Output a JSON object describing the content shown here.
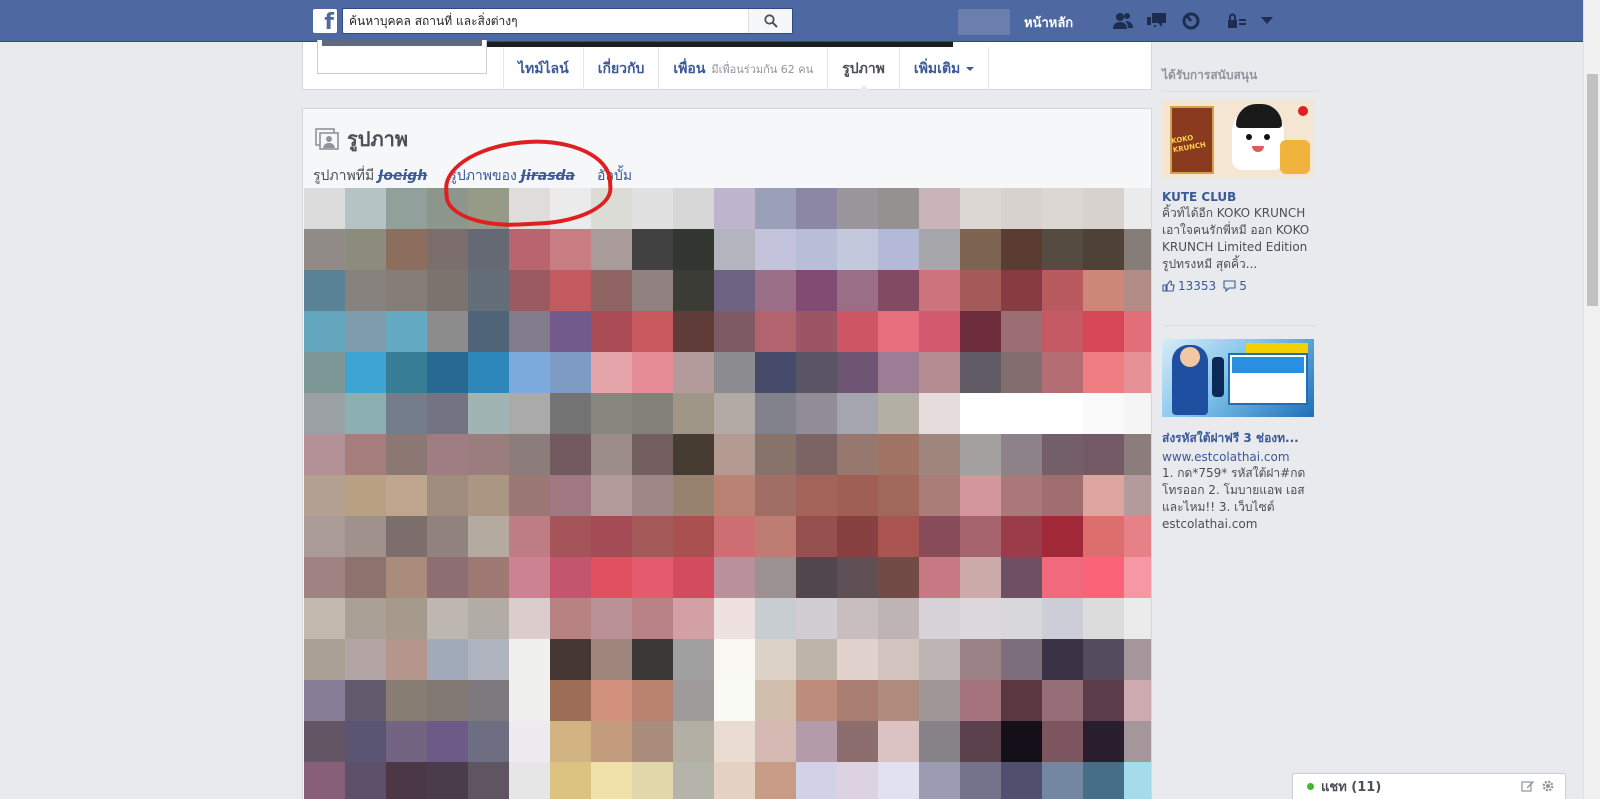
{
  "topbar": {
    "logo": "f",
    "search_placeholder": "ค้นหาบุคคล สถานที่ และสิ่งต่างๆ",
    "home_label": "หน้าหลัก",
    "icons": [
      "friend-requests-icon",
      "messages-icon",
      "notifications-icon",
      "privacy-lock-icon",
      "account-menu-caret-icon"
    ]
  },
  "timeline_nav": {
    "tabs": [
      {
        "label": "ไทม์ไลน์"
      },
      {
        "label": "เกี่ยวกับ"
      },
      {
        "label": "เพื่อน",
        "sub": "มีเพื่อนร่วมกัน 62 คน"
      },
      {
        "label": "รูปภาพ",
        "active": true
      },
      {
        "label": "เพิ่มเติม"
      }
    ]
  },
  "photos": {
    "title": "รูปภาพ",
    "subtabs": {
      "photos_of_prefix": "รูปภาพที่มี",
      "photos_of_name": "Joeigh",
      "photos_by_prefix": "รูปภาพของ",
      "photos_by_name": "Jirasda",
      "albums": "อัลบั้ม"
    },
    "mosaic_colors": [
      [
        "#dcdcdc",
        "#b4c3c3",
        "#91a09b",
        "#8c968c",
        "#969b87",
        "#e1dcdc",
        "#ebebeb",
        "#dcdcd7",
        "#e1e1e1",
        "#d7d7d7",
        "#beb4cd",
        "#9ba0b9",
        "#8c87a5",
        "#9b969b",
        "#969191",
        "#c8b4b9",
        "#dcd7d2",
        "#d7d2cd",
        "#dcd7d2",
        "#d7d2cd",
        "#ebebeb"
      ],
      [
        "#918c87",
        "#8c8c7d",
        "#8c6e5f",
        "#7d6e6e",
        "#646973",
        "#b9646e",
        "#c87d82",
        "#aa9b9b",
        "#414141",
        "#323732",
        "#b4b4be",
        "#c3c3dc",
        "#b9bed7",
        "#c3c8dc",
        "#b4b9d7",
        "#a5a5aa",
        "#7d6450",
        "#5a3c32",
        "#554b41",
        "#504137",
        "#877d78"
      ],
      [
        "#5a8296",
        "#87827d",
        "#877d78",
        "#7d736e",
        "#646e78",
        "#9b5a5f",
        "#c35a5f",
        "#916464",
        "#918282",
        "#3c3c37",
        "#6e6482",
        "#9b6e87",
        "#824b73",
        "#9b6e87",
        "#824b64",
        "#cd737d",
        "#a55a5a",
        "#873c41",
        "#b95a5f",
        "#cd8778",
        "#b48c87"
      ],
      [
        "#64a5be",
        "#7d9baa",
        "#64aac3",
        "#8c8c8c",
        "#506478",
        "#827d8c",
        "#735a8c",
        "#aa4b55",
        "#c85a5f",
        "#5f3c37",
        "#7d5a64",
        "#b4646e",
        "#9b5564",
        "#cd5564",
        "#e66e7d",
        "#d25a6e",
        "#6e2d3c",
        "#9b6e73",
        "#c35a64",
        "#d74655",
        "#e16e78"
      ],
      [
        "#7d9696",
        "#3ca5d2",
        "#377d96",
        "#286991",
        "#2d87b9",
        "#7daadc",
        "#7d9bc3",
        "#e6a5aa",
        "#e68c96",
        "#b49b9b",
        "#8c8c91",
        "#464b69",
        "#5a5564",
        "#6e5573",
        "#9b7d96",
        "#b48c91",
        "#5f5a64",
        "#826e6e",
        "#b46e73",
        "#f07d82",
        "#e69196"
      ],
      [
        "#9ba0a5",
        "#8cafb4",
        "#737d8c",
        "#737382",
        "#a0b4b4",
        "#aaaaaa",
        "#737373",
        "#87877d",
        "#828278",
        "#a09687",
        "#b4aaa5",
        "#82828c",
        "#918c96",
        "#a5a5af",
        "#b4afa5",
        "#e6dcdc",
        "#ffffff",
        "#ffffff",
        "#ffffff",
        "#fafafa",
        "#f5f5f5"
      ],
      [
        "#b49196",
        "#a57d7d",
        "#8c7873",
        "#a07d82",
        "#9b7d7d",
        "#8c7d7d",
        "#735a5f",
        "#9b8c87",
        "#735f5f",
        "#463c32",
        "#b49b91",
        "#877369",
        "#7d6464",
        "#96786e",
        "#a07364",
        "#a0877d",
        "#a5a0a0",
        "#8c8287",
        "#735f69",
        "#735a64",
        "#8c7d7d"
      ],
      [
        "#b4a091",
        "#b9a082",
        "#bea58c",
        "#a08c7d",
        "#aa9682",
        "#9b7873",
        "#a07882",
        "#b49b9b",
        "#a08787",
        "#96826e",
        "#b98273",
        "#a06e64",
        "#a5645a",
        "#a05f55",
        "#a0695a",
        "#aa7d78",
        "#d2969b",
        "#aa7878",
        "#a06e6e",
        "#dca5a0",
        "#b49b9b"
      ],
      [
        "#aa9b96",
        "#a0918c",
        "#7d6e6e",
        "#91827d",
        "#b4aaa0",
        "#be7d82",
        "#a5555a",
        "#a54b55",
        "#a55a5a",
        "#aa5050",
        "#cd6e73",
        "#be7d73",
        "#965050",
        "#874141",
        "#aa5550",
        "#874b5a",
        "#a5646e",
        "#9b3c4b",
        "#a02837",
        "#dc6e6e",
        "#e68287"
      ],
      [
        "#a08282",
        "#8c736e",
        "#aa8c7d",
        "#8c6e73",
        "#a07873",
        "#cd8291",
        "#c3556e",
        "#e1505f",
        "#e65a6e",
        "#d24b5f",
        "#b9919b",
        "#9b9191",
        "#50464b",
        "#5f5055",
        "#734b46",
        "#c87882",
        "#cdaaaa",
        "#6e5064",
        "#f0697d",
        "#fa6478",
        "#f597a5"
      ],
      [
        "#c3b9af",
        "#aaa096",
        "#a59a8c",
        "#bdb7b0",
        "#b1aca6",
        "#dccdcd",
        "#b98282",
        "#b99196",
        "#b98287",
        "#d2a0a5",
        "#f0e1e1",
        "#c8cdd2",
        "#d2cdd2",
        "#c8bebe",
        "#beb4b4",
        "#d7d2d7",
        "#dcd7dc",
        "#d7d7dc",
        "#cdcdd7",
        "#dcdcdc",
        "#ebebeb"
      ],
      [
        "#aaa096",
        "#b4a5a5",
        "#b4968c",
        "#a0aab9",
        "#afb4be",
        "#f0f0ee",
        "#463732",
        "#a0877d",
        "#3c3737",
        "#a0a0a0",
        "#faf8f2",
        "#dcd2c8",
        "#beb4aa",
        "#e1d2cd",
        "#d2c3be",
        "#beb4b4",
        "#9b8287",
        "#7d6e7d",
        "#3c3246",
        "#554b5f",
        "#a5969b"
      ],
      [
        "#877d96",
        "#645a6e",
        "#877d73",
        "#827873",
        "#7d787d",
        "#f0f0ee",
        "#9b6e55",
        "#d2917d",
        "#b9826e",
        "#a09b9b",
        "#fafaf5",
        "#d2bead",
        "#be8c7d",
        "#aa7d73",
        "#af8c7d",
        "#a09696",
        "#a5737d",
        "#5a3741",
        "#966e78",
        "#5a3c4b",
        "#cdaaaf"
      ],
      [
        "#645564",
        "#5a5573",
        "#736482",
        "#6e5a87",
        "#6e6e82",
        "#eeeaf0",
        "#d2b482",
        "#c39b7d",
        "#aa8c7d",
        "#b4afa5",
        "#ebdcd2",
        "#d7b9b4",
        "#b49baa",
        "#8c6e6e",
        "#dcc3c3",
        "#878287",
        "#5a414b",
        "#140f19",
        "#7d555f",
        "#281e2d",
        "#a5969b"
      ],
      [
        "#875f78",
        "#5f5069",
        "#4b3746",
        "#4b3c4b",
        "#5f5560",
        "#e6e6e6",
        "#dcc382",
        "#f0e1aa",
        "#e1d7aa",
        "#b4b4aa",
        "#e6d2c3",
        "#c89b87",
        "#d2d2e6",
        "#dcd2e1",
        "#e1e1f0",
        "#9b9bb4",
        "#73738c",
        "#50506e",
        "#7387a0",
        "#466e87",
        "#a5dceb"
      ]
    ]
  },
  "sidebar": {
    "sponsored_label": "ได้รับการสนับสนุน",
    "ads": [
      {
        "title": "KUTE CLUB",
        "body": "คิ้วท์ได้อีก KOKO KRUNCH เอาใจคนรักพี่หมี ออก KOKO KRUNCH Limited Edition รูปทรงหมี สุดคิ้ว...",
        "likes": "13353",
        "comments": "5",
        "image_text": "KOKO KRUNCH"
      },
      {
        "title": "ส่งรหัสใต้ฝาฟรี 3 ช่องท...",
        "url": "www.estcolathai.com",
        "body": "1. กด*759* รหัสใต้ฝา#กด โทรออก 2. โมบายแอพ เอส และไหม!! 3. เว็บไซต์ estcolathai.com"
      }
    ]
  },
  "chat": {
    "label": "แชท (11)"
  }
}
